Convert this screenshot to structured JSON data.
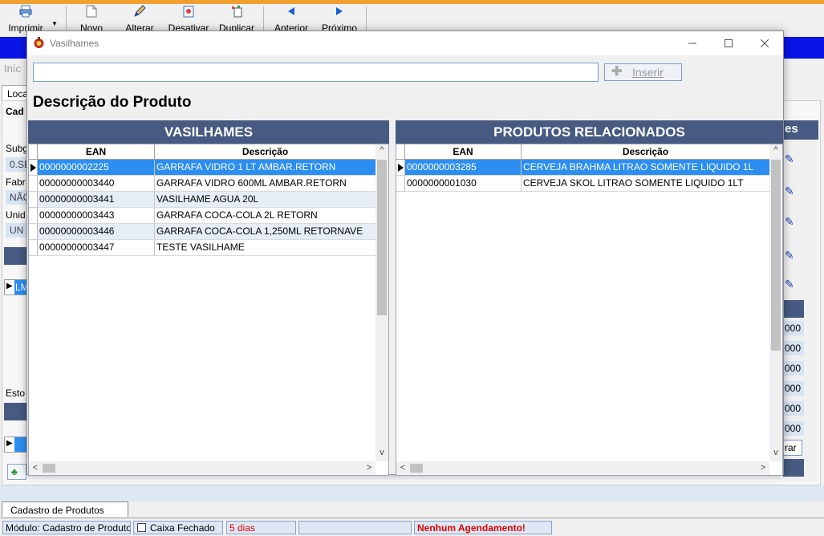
{
  "toolbar": {
    "print": "Imprimir",
    "new": "Novo",
    "edit": "Alterar",
    "deactivate": "Desativar",
    "duplicate": "Duplicar",
    "previous": "Anterior",
    "next": "Próximo"
  },
  "background": {
    "breadcrumb": "Iníc",
    "tab_local": "Loca",
    "tab_cad": "Cad",
    "label_subgroup": "Subg",
    "field_subgroup": "0.SE",
    "label_manufacturer": "Fabr",
    "field_manufacturer": "NÃO",
    "label_unit": "Unid",
    "field_unit": "UN",
    "row_value": "LM",
    "label_stock": "Esto",
    "right_header": "es",
    "right_values": [
      "000",
      "000",
      "000",
      "000",
      "000",
      "000"
    ],
    "right_button": "rar"
  },
  "dialog": {
    "title": "Vasilhames",
    "search_value": "",
    "search_placeholder": "",
    "insert_button": "Inserir",
    "product_description_title": "Descrição do Produto"
  },
  "left_grid": {
    "title": "VASILHAMES",
    "columns": [
      "EAN",
      "Descrição"
    ],
    "rows": [
      {
        "ean": "0000000002225",
        "desc": "GARRAFA VIDRO 1 LT AMBAR.RETORN",
        "selected": true
      },
      {
        "ean": "00000000003440",
        "desc": "GARRAFA VIDRO 600ML AMBAR.RETORN"
      },
      {
        "ean": "00000000003441",
        "desc": "VASILHAME AGUA 20L"
      },
      {
        "ean": "00000000003443",
        "desc": "GARRAFA COCA-COLA 2L RETORN"
      },
      {
        "ean": "00000000003446",
        "desc": "GARRAFA COCA-COLA 1,250ML RETORNAVE"
      },
      {
        "ean": "00000000003447",
        "desc": "TESTE VASILHAME"
      }
    ]
  },
  "right_grid": {
    "title": "PRODUTOS RELACIONADOS",
    "columns": [
      "EAN",
      "Descrição"
    ],
    "rows": [
      {
        "ean": "0000000003285",
        "desc": "CERVEJA BRAHMA LITRAO SOMENTE LIQUIDO 1L",
        "selected": true
      },
      {
        "ean": "0000000001030",
        "desc": "CERVEJA SKOL LITRAO SOMENTE LIQUIDO 1LT"
      }
    ]
  },
  "bottom": {
    "module_tab": "Cadastro de Produtos",
    "status_module": "Módulo: Cadastro de Produto",
    "status_cash": "Caixa Fechado",
    "status_days": "5 dias",
    "status_schedule": "Nenhum Agendamento!"
  },
  "colors": {
    "header_blue": "#465a82",
    "selection_blue": "#2c8ef0",
    "alt_row": "#e6edf7",
    "band_blue": "#0a14e6",
    "status_red": "#e00000"
  }
}
